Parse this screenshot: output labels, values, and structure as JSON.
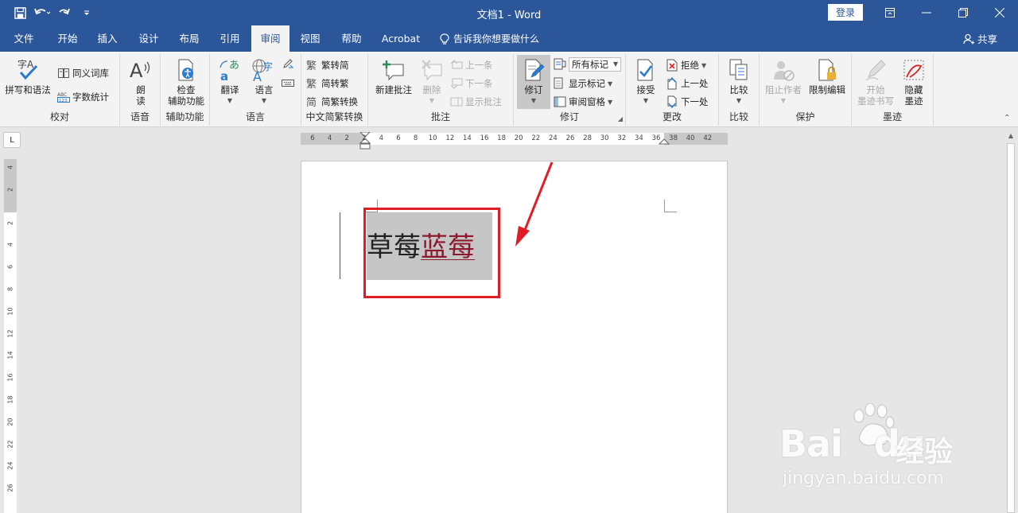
{
  "titlebar": {
    "title": "文档1 - Word",
    "login": "登录"
  },
  "tabs": [
    "文件",
    "开始",
    "插入",
    "设计",
    "布局",
    "引用",
    "审阅",
    "视图",
    "帮助",
    "Acrobat"
  ],
  "active_tab": "审阅",
  "tell_me": "告诉我你想要做什么",
  "share": "共享",
  "ribbon": {
    "proofing": {
      "label": "校对",
      "spelling": "拼写和语法",
      "thesaurus": "同义词库",
      "wordcount": "字数统计"
    },
    "speech": {
      "label": "语音",
      "read_aloud": "朗\n读"
    },
    "accessibility": {
      "label": "辅助功能",
      "check": "检查\n辅助功能"
    },
    "language": {
      "label": "语言",
      "translate": "翻译",
      "language": "语言"
    },
    "chinese": {
      "label": "中文简繁转换",
      "to_simplified": "繁转简",
      "to_traditional": "简转繁",
      "convert": "简繁转换"
    },
    "comments": {
      "label": "批注",
      "new": "新建批注",
      "delete": "删除",
      "prev": "上一条",
      "next": "下一条",
      "show": "显示批注"
    },
    "tracking": {
      "label": "修订",
      "track": "修订",
      "markup": "所有标记",
      "show_markup": "显示标记",
      "pane": "审阅窗格"
    },
    "changes": {
      "label": "更改",
      "accept": "接受",
      "reject": "拒绝",
      "prev": "上一处",
      "next": "下一处"
    },
    "compare": {
      "label": "比较",
      "compare": "比较"
    },
    "protect": {
      "label": "保护",
      "block": "阻止作者",
      "restrict": "限制编辑"
    },
    "ink": {
      "label": "墨迹",
      "start": "开始\n墨迹书写",
      "hide": "隐藏\n墨迹"
    }
  },
  "ruler": {
    "corner": "L",
    "h_ticks": [
      "6",
      "4",
      "2",
      "2",
      "4",
      "6",
      "8",
      "10",
      "12",
      "14",
      "16",
      "18",
      "20",
      "22",
      "24",
      "26",
      "28",
      "30",
      "32",
      "34",
      "36",
      "38",
      "40",
      "42"
    ],
    "v_ticks": [
      "4",
      "2",
      "2",
      "4",
      "6",
      "8",
      "10",
      "12",
      "14",
      "16",
      "18",
      "20",
      "22",
      "24",
      "26"
    ]
  },
  "document": {
    "original_text": "草莓",
    "inserted_text": "蓝莓"
  },
  "watermark": {
    "brand": "Bai",
    "brand2": "du",
    "brand_cn": "经验",
    "url": "jingyan.baidu.com"
  },
  "colors": {
    "title_bar": "#2b579a",
    "ribbon_bg": "#f3f3f3",
    "insertion": "#8b1a2e",
    "highlight_box": "#e01c24"
  }
}
